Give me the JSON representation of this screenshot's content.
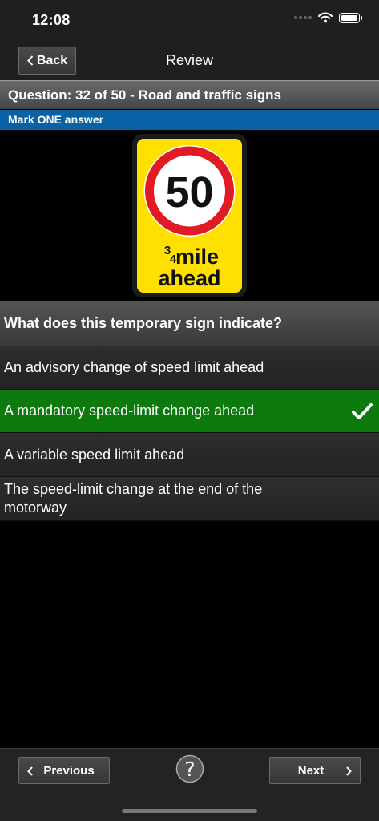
{
  "status": {
    "time": "12:08"
  },
  "nav": {
    "back_label": "Back",
    "title": "Review"
  },
  "question": {
    "header": "Question: 32 of 50 - Road and traffic signs",
    "instruction": "Mark ONE answer",
    "text": "What does this temporary sign indicate?"
  },
  "sign": {
    "speed": "50",
    "fraction_top": "3",
    "fraction_bottom": "4",
    "line1": "mile",
    "line2": "ahead",
    "colors": {
      "background": "#ffe000",
      "ring": "#e01b24",
      "text": "#111111"
    }
  },
  "answers": [
    {
      "text": "An advisory change of speed limit ahead",
      "correct": false
    },
    {
      "text": "A mandatory speed-limit change ahead",
      "correct": true
    },
    {
      "text": "A variable speed limit ahead",
      "correct": false
    },
    {
      "text": "The speed-limit change at the end of the motorway",
      "correct": false
    }
  ],
  "toolbar": {
    "previous_label": "Previous",
    "next_label": "Next"
  },
  "colors": {
    "correct": "#0c7a0c",
    "accent": "#0a62a6"
  }
}
